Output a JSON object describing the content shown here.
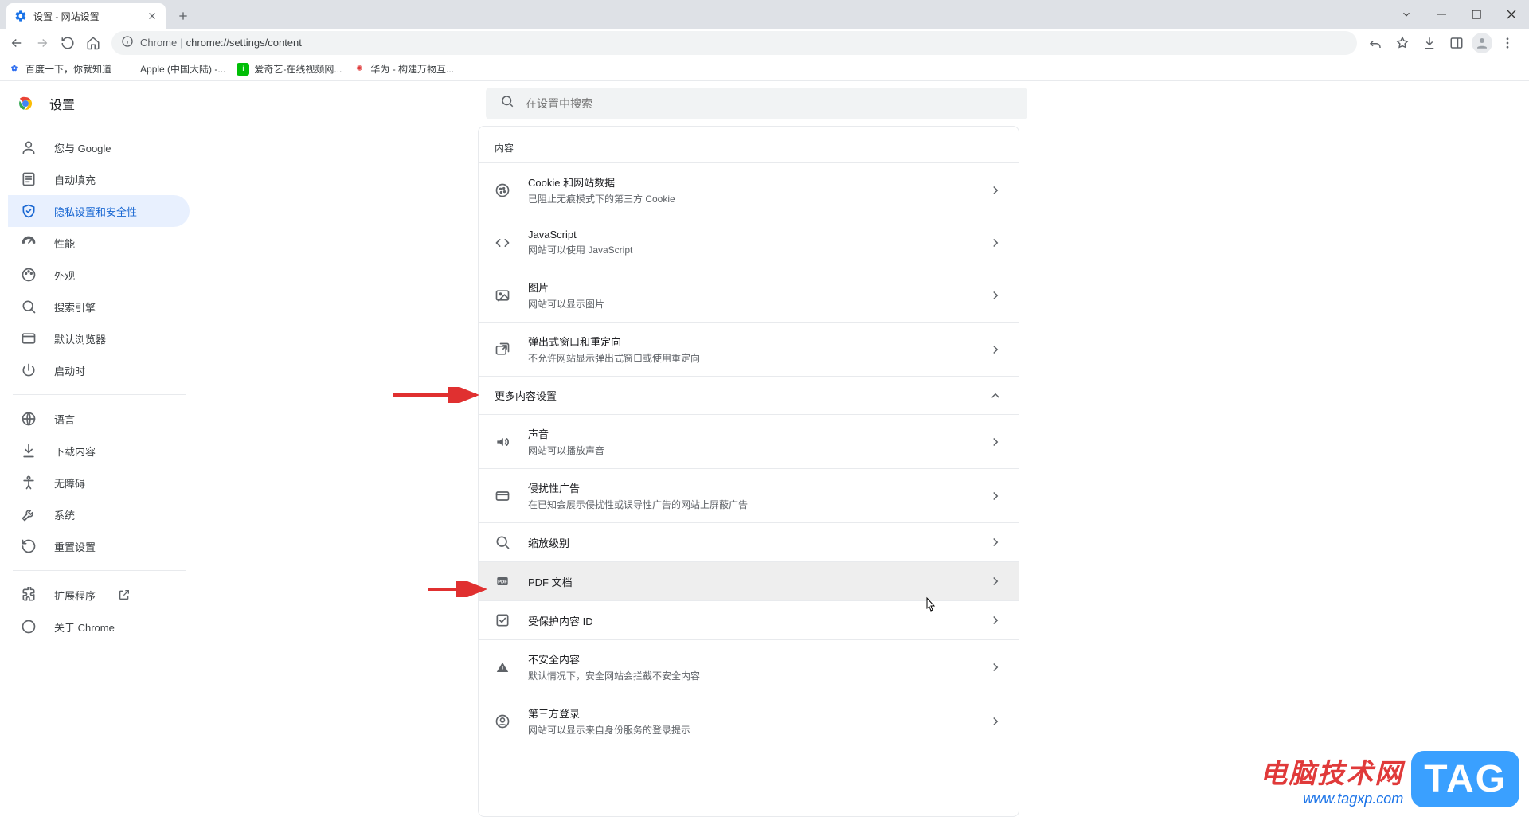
{
  "titlebar": {
    "tab_title": "设置 - 网站设置"
  },
  "toolbar": {
    "chrome_label": "Chrome",
    "url": "chrome://settings/content"
  },
  "bookmarks": [
    {
      "label": "百度一下，你就知道",
      "color": "#2e6ef0",
      "text_icon": ""
    },
    {
      "label": "Apple (中国大陆) -...",
      "color": "#888",
      "text_icon": ""
    },
    {
      "label": "爱奇艺-在线视频网...",
      "color": "#00be06",
      "text_icon": "aq"
    },
    {
      "label": "华为 - 构建万物互...",
      "color": "#e03a3a",
      "text_icon": ""
    }
  ],
  "settings_header": {
    "title": "设置",
    "search_placeholder": "在设置中搜索"
  },
  "sidebar": {
    "groups": [
      [
        {
          "label": "您与 Google",
          "icon": "person"
        },
        {
          "label": "自动填充",
          "icon": "autofill"
        },
        {
          "label": "隐私设置和安全性",
          "icon": "shield",
          "active": true
        },
        {
          "label": "性能",
          "icon": "speed"
        },
        {
          "label": "外观",
          "icon": "palette"
        },
        {
          "label": "搜索引擎",
          "icon": "search"
        },
        {
          "label": "默认浏览器",
          "icon": "browser"
        },
        {
          "label": "启动时",
          "icon": "power"
        }
      ],
      [
        {
          "label": "语言",
          "icon": "globe"
        },
        {
          "label": "下载内容",
          "icon": "download"
        },
        {
          "label": "无障碍",
          "icon": "a11y"
        },
        {
          "label": "系统",
          "icon": "wrench"
        },
        {
          "label": "重置设置",
          "icon": "restore"
        }
      ],
      [
        {
          "label": "扩展程序",
          "icon": "ext",
          "external": true
        },
        {
          "label": "关于 Chrome",
          "icon": "about"
        }
      ]
    ]
  },
  "panel": {
    "content_section": "内容",
    "rows": [
      {
        "icon": "cookie",
        "title": "Cookie 和网站数据",
        "sub": "已阻止无痕模式下的第三方 Cookie"
      },
      {
        "icon": "code",
        "title": "JavaScript",
        "sub": "网站可以使用 JavaScript"
      },
      {
        "icon": "image",
        "title": "图片",
        "sub": "网站可以显示图片"
      },
      {
        "icon": "popup",
        "title": "弹出式窗口和重定向",
        "sub": "不允许网站显示弹出式窗口或使用重定向"
      }
    ],
    "more_section": "更多内容设置",
    "more_rows": [
      {
        "icon": "sound",
        "title": "声音",
        "sub": "网站可以播放声音"
      },
      {
        "icon": "ads",
        "title": "侵扰性广告",
        "sub": "在已知会展示侵扰性或误导性广告的网站上屏蔽广告"
      },
      {
        "icon": "zoom",
        "title": "缩放级别",
        "sub": ""
      },
      {
        "icon": "pdf",
        "title": "PDF 文档",
        "sub": "",
        "hovered": true
      },
      {
        "icon": "protected",
        "title": "受保护内容 ID",
        "sub": ""
      },
      {
        "icon": "warn",
        "title": "不安全内容",
        "sub": "默认情况下，安全网站会拦截不安全内容"
      },
      {
        "icon": "idcard",
        "title": "第三方登录",
        "sub": "网站可以显示来自身份服务的登录提示"
      }
    ]
  },
  "watermark": {
    "line1": "电脑技术网",
    "line2": "www.tagxp.com",
    "tag": "TAG"
  }
}
